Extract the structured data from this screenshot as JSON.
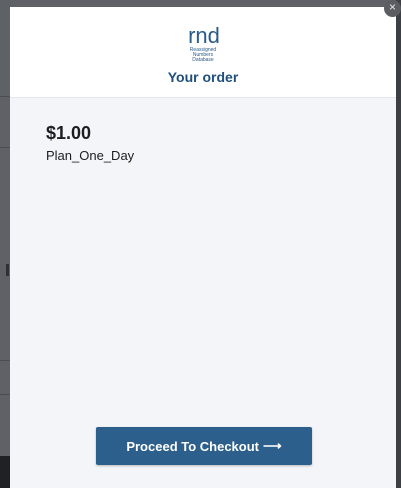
{
  "modal": {
    "logo_text": "rnd",
    "logo_tagline": [
      "Reassigned",
      "Numbers",
      "Database"
    ],
    "title": "Your order",
    "close_icon": "×"
  },
  "order": {
    "price": "$1.00",
    "plan_name": "Plan_One_Day"
  },
  "checkout": {
    "label": "Proceed To Checkout",
    "arrow_icon": "⟶"
  },
  "colors": {
    "brand": "#1f4f7c",
    "button": "#2d5f8c",
    "panel": "#f3f5f9"
  }
}
